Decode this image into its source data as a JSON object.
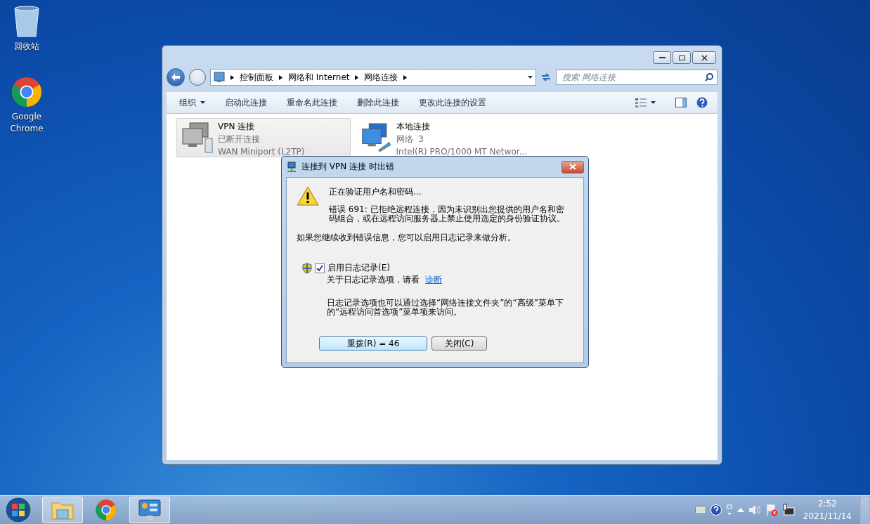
{
  "desktop_icons": [
    {
      "kind": "recycle",
      "label": "回收站"
    },
    {
      "kind": "chrome",
      "label": "Google Chrome"
    }
  ],
  "explorer": {
    "breadcrumb": [
      "控制面板",
      "网络和 Internet",
      "网络连接"
    ],
    "search": {
      "placeholder": "搜索 网络连接"
    },
    "toolbar": [
      {
        "label": "组织",
        "dropdown": true
      },
      {
        "label": "启动此连接",
        "dropdown": false
      },
      {
        "label": "重命名此连接",
        "dropdown": false
      },
      {
        "label": "删除此连接",
        "dropdown": false
      },
      {
        "label": "更改此连接的设置",
        "dropdown": false
      }
    ],
    "connections": [
      {
        "kind": "vpn",
        "name": "VPN 连接",
        "status": "已断开连接",
        "device": "WAN Miniport (L2TP)",
        "selected": true
      },
      {
        "kind": "lan",
        "name": "本地连接",
        "status": "网络  3",
        "device": "Intel(R) PRO/1000 MT Networ...",
        "selected": false
      }
    ]
  },
  "dialog": {
    "title": "连接到 VPN 连接 时出错",
    "status_text": "正在验证用户名和密码...",
    "error_text": "错误 691: 已拒绝远程连接，因为未识别出您提供的用户名和密码组合，或在远程访问服务器上禁止使用选定的身份验证协议。",
    "hint_text": "如果您继续收到错误信息，您可以启用日志记录来做分析。",
    "logging": {
      "label": "启用日志记录(E)",
      "checked": true
    },
    "about_text": "关于日志记录选项，请看",
    "about_link": "诊断",
    "note": "日志记录选项也可以通过选择“网络连接文件夹”的“高级”菜单下的“远程访问首选项”菜单项来访问。",
    "buttons": [
      {
        "label": "重拨(R) = 46",
        "focused": true
      },
      {
        "label": "关闭(C)",
        "focused": false
      }
    ]
  },
  "taskbar": {
    "apps": [
      {
        "kind": "explorer",
        "open": true
      },
      {
        "kind": "chrome",
        "open": false
      },
      {
        "kind": "network",
        "open": true
      }
    ],
    "time": "2:52",
    "date": "2021/11/14"
  }
}
